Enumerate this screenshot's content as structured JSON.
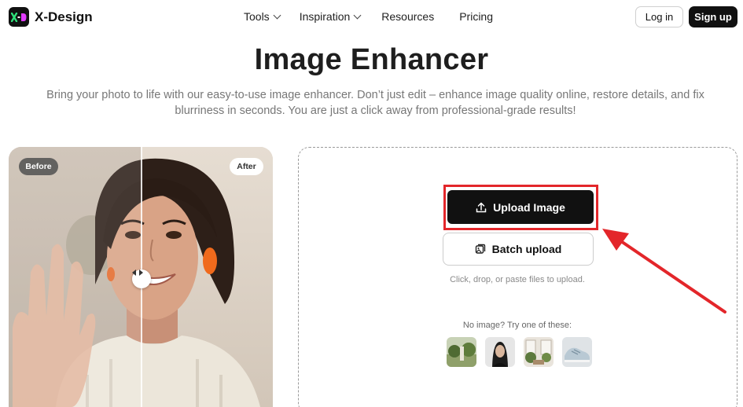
{
  "nav": {
    "brand": "X-Design",
    "menu": [
      {
        "label": "Tools",
        "has_dropdown": true
      },
      {
        "label": "Inspiration",
        "has_dropdown": true
      },
      {
        "label": "Resources",
        "has_dropdown": false
      },
      {
        "label": "Pricing",
        "has_dropdown": false
      }
    ],
    "login_label": "Log in",
    "signup_label": "Sign up"
  },
  "hero": {
    "title": "Image Enhancer",
    "subtitle": "Bring your photo to life with our easy-to-use image enhancer. Don’t just edit – enhance image quality online, restore details, and fix blurriness in seconds. You are just a click away from professional-grade results!"
  },
  "compare": {
    "before_label": "Before",
    "after_label": "After"
  },
  "upload": {
    "upload_label": "Upload Image",
    "batch_label": "Batch upload",
    "hint": "Click, drop, or paste files to upload.",
    "try_text": "No image? Try one of these:",
    "samples": [
      "sample-plant-image",
      "sample-portrait-image",
      "sample-room-image",
      "sample-sneaker-image"
    ]
  },
  "colors": {
    "brand_dark": "#111111",
    "highlight_red": "#e3262a",
    "logo_green": "#2ee07a",
    "logo_pink": "#e23cff"
  },
  "icons": [
    "chevron-down-icon",
    "upload-icon",
    "batch-upload-icon",
    "slider-handle-icon",
    "red-arrow"
  ]
}
